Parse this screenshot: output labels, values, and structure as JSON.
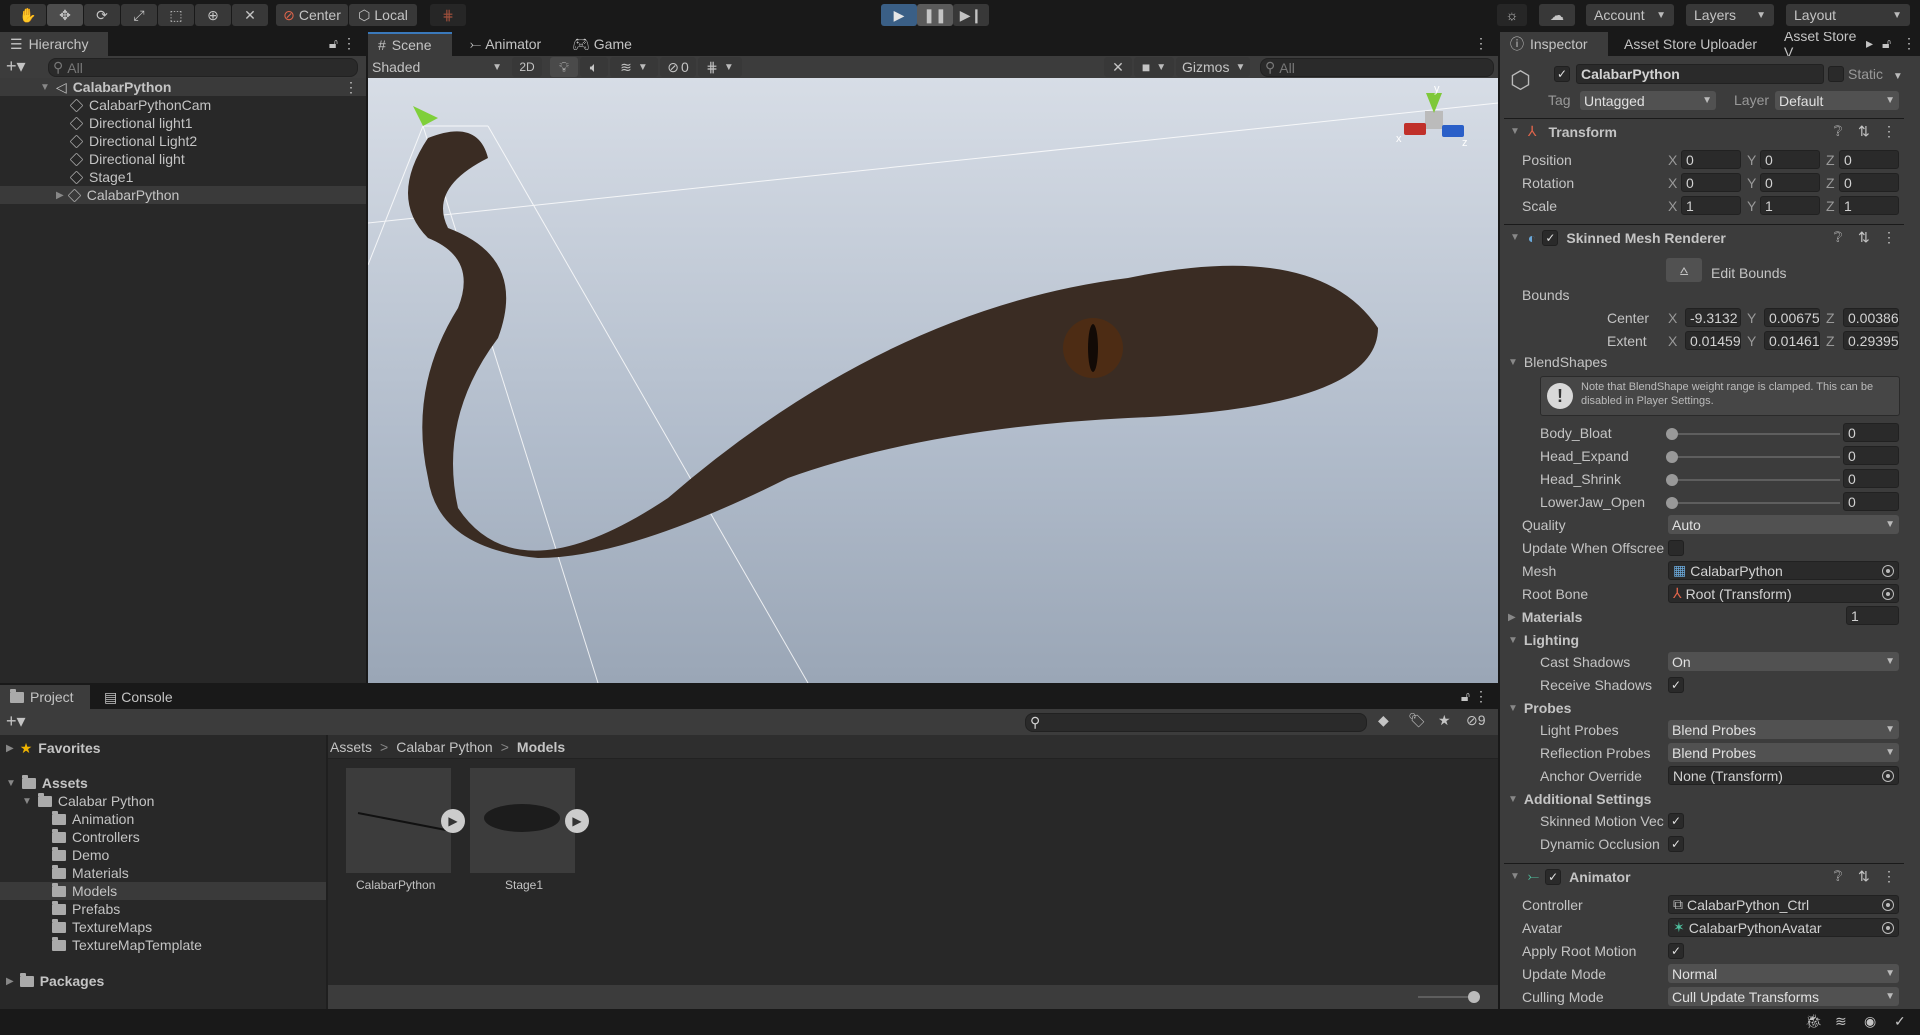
{
  "toolbar": {
    "tools": [
      "hand-tool",
      "move-tool",
      "rotate-tool",
      "scale-tool",
      "rect-tool",
      "transform-tool",
      "custom-tool"
    ],
    "pivot_mode": "Center",
    "pivot_rotation": "Local",
    "account": "Account",
    "layers": "Layers",
    "layout": "Layout"
  },
  "hierarchy": {
    "tab": "Hierarchy",
    "search_placeholder": "All",
    "root": "CalabarPython",
    "items": [
      "CalabarPythonCam",
      "Directional light1",
      "Directional Light2",
      "Directional light",
      "Stage1",
      "CalabarPython"
    ]
  },
  "scene": {
    "tabs": [
      "Scene",
      "Animator",
      "Game"
    ],
    "shading": "Shaded",
    "mode_2d": "2D",
    "hidden_count": "0",
    "gizmos": "Gizmos",
    "search_placeholder": "All",
    "axis_labels": {
      "x": "x",
      "y": "y",
      "z": "z"
    }
  },
  "project": {
    "tabs": [
      "Project",
      "Console"
    ],
    "favorites": "Favorites",
    "assets": "Assets",
    "calabar": "Calabar Python",
    "folders": [
      "Animation",
      "Controllers",
      "Demo",
      "Materials",
      "Models",
      "Prefabs",
      "TextureMaps",
      "TextureMapTemplate"
    ],
    "selected_folder": "Models",
    "packages": "Packages",
    "breadcrumb": [
      "Assets",
      "Calabar Python",
      "Models"
    ],
    "assets_grid": [
      "CalabarPython",
      "Stage1"
    ],
    "hidden_count": "9"
  },
  "inspector": {
    "tabs": [
      "Inspector",
      "Asset Store Uploader",
      "Asset Store V"
    ],
    "object_name": "CalabarPython",
    "static_label": "Static",
    "tag_label": "Tag",
    "tag": "Untagged",
    "layer_label": "Layer",
    "layer": "Default",
    "transform": {
      "title": "Transform",
      "rows": [
        {
          "label": "Position",
          "x": "0",
          "y": "0",
          "z": "0"
        },
        {
          "label": "Rotation",
          "x": "0",
          "y": "0",
          "z": "0"
        },
        {
          "label": "Scale",
          "x": "1",
          "y": "1",
          "z": "1"
        }
      ]
    },
    "smr": {
      "title": "Skinned Mesh Renderer",
      "edit_bounds": "Edit Bounds",
      "bounds": "Bounds",
      "center": {
        "label": "Center",
        "x": "-9.3132",
        "y": "0.00675",
        "z": "0.00386"
      },
      "extent": {
        "label": "Extent",
        "x": "0.01459",
        "y": "0.01461",
        "z": "0.29395"
      },
      "blendshapes": "BlendShapes",
      "note": "Note that BlendShape weight range is clamped. This can be disabled in Player Settings.",
      "shapes": [
        {
          "label": "Body_Bloat",
          "value": "0"
        },
        {
          "label": "Head_Expand",
          "value": "0"
        },
        {
          "label": "Head_Shrink",
          "value": "0"
        },
        {
          "label": "LowerJaw_Open",
          "value": "0"
        }
      ],
      "quality_label": "Quality",
      "quality": "Auto",
      "update_offscreen": "Update When Offscree",
      "mesh_label": "Mesh",
      "mesh": "CalabarPython",
      "root_bone_label": "Root Bone",
      "root_bone": "Root (Transform)",
      "materials": "Materials",
      "materials_count": "1",
      "lighting": "Lighting",
      "cast_shadows_label": "Cast Shadows",
      "cast_shadows": "On",
      "receive_shadows": "Receive Shadows",
      "probes": "Probes",
      "light_probes_label": "Light Probes",
      "light_probes": "Blend Probes",
      "reflection_probes_label": "Reflection Probes",
      "reflection_probes": "Blend Probes",
      "anchor_label": "Anchor Override",
      "anchor": "None (Transform)",
      "additional": "Additional Settings",
      "motion_vectors": "Skinned Motion Vec",
      "dynamic_occlusion": "Dynamic Occlusion"
    },
    "animator": {
      "title": "Animator",
      "controller_label": "Controller",
      "controller": "CalabarPython_Ctrl",
      "avatar_label": "Avatar",
      "avatar": "CalabarPythonAvatar",
      "root_motion": "Apply Root Motion",
      "update_mode_label": "Update Mode",
      "update_mode": "Normal",
      "culling_label": "Culling Mode",
      "culling": "Cull Update Transforms"
    }
  }
}
